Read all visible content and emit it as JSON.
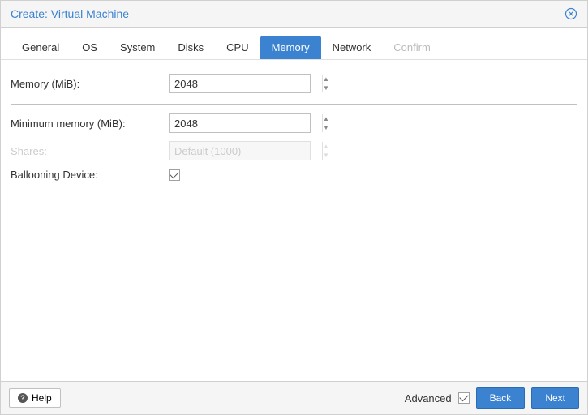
{
  "header": {
    "title": "Create: Virtual Machine"
  },
  "tabs": {
    "general": "General",
    "os": "OS",
    "system": "System",
    "disks": "Disks",
    "cpu": "CPU",
    "memory": "Memory",
    "network": "Network",
    "confirm": "Confirm"
  },
  "form": {
    "memory": {
      "label": "Memory (MiB):",
      "value": "2048"
    },
    "minmemory": {
      "label": "Minimum memory (MiB):",
      "value": "2048"
    },
    "shares": {
      "label": "Shares:",
      "placeholder": "Default (1000)"
    },
    "ballooning": {
      "label": "Ballooning Device:"
    }
  },
  "footer": {
    "help": "Help",
    "advanced": "Advanced",
    "back": "Back",
    "next": "Next"
  }
}
